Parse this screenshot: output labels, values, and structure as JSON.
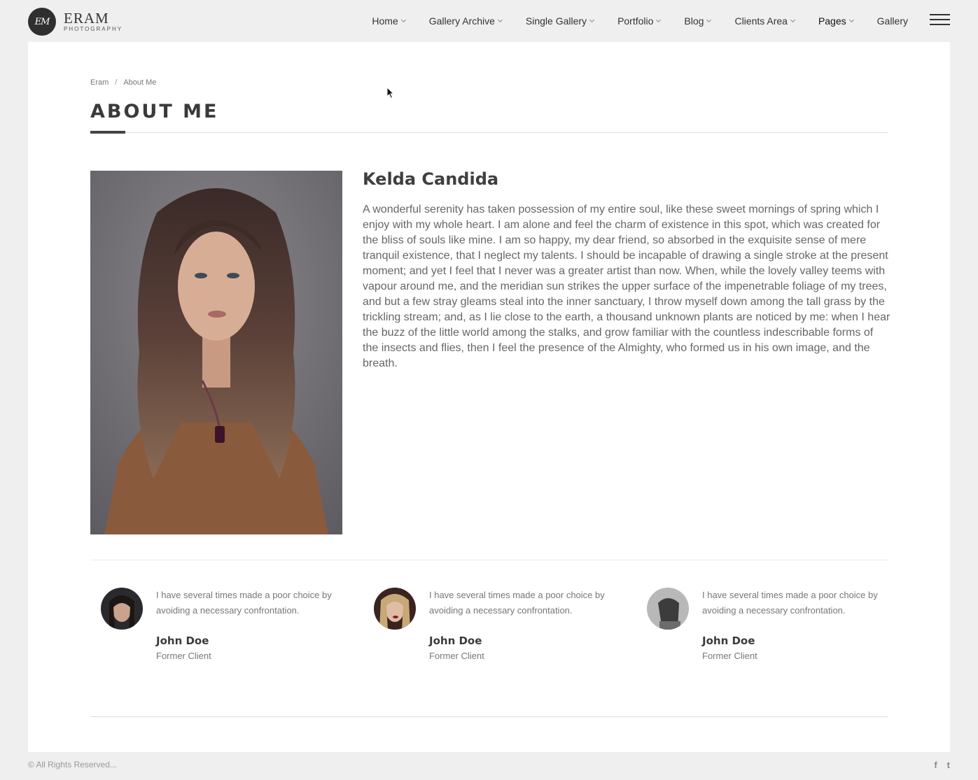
{
  "brand": {
    "monogram": "EM",
    "name": "ERAM",
    "sub": "PHOTOGRAPHY"
  },
  "nav": {
    "items": [
      {
        "label": "Home",
        "dropdown": true
      },
      {
        "label": "Gallery Archive",
        "dropdown": true
      },
      {
        "label": "Single Gallery",
        "dropdown": true
      },
      {
        "label": "Portfolio",
        "dropdown": true
      },
      {
        "label": "Blog",
        "dropdown": true
      },
      {
        "label": "Clients Area",
        "dropdown": true
      },
      {
        "label": "Pages",
        "dropdown": true,
        "active": true
      },
      {
        "label": "Gallery",
        "dropdown": false
      }
    ],
    "menu_icon": "hamburger-icon"
  },
  "breadcrumb": {
    "home": "Eram",
    "separator": "/",
    "current": "About Me"
  },
  "page": {
    "title": "ABOUT ME"
  },
  "profile": {
    "name": "Kelda Candida",
    "bio": "A wonderful serenity has taken possession of my entire soul, like these sweet mornings of spring which I enjoy with my whole heart. I am alone and feel the charm of existence in this spot, which was created for the bliss of souls like mine. I am so happy, my dear friend, so absorbed in the exquisite sense of mere tranquil existence, that I neglect my talents. I should be incapable of drawing a single stroke at the present moment; and yet I feel that I never was a greater artist than now. When, while the lovely valley teems with vapour around me, and the meridian sun strikes the upper surface of the impenetrable foliage of my trees, and but a few stray gleams steal into the inner sanctuary, I throw myself down among the tall grass by the trickling stream; and, as I lie close to the earth, a thousand unknown plants are noticed by me: when I hear the buzz of the little world among the stalks, and grow familiar with the countless indescribable forms of the insects and flies, then I feel the presence of the Almighty, who formed us in his own image, and the breath."
  },
  "testimonials": [
    {
      "quote": "I have several times made a poor choice by avoiding a necessary confrontation.",
      "name": "John Doe",
      "role": "Former Client"
    },
    {
      "quote": "I have several times made a poor choice by avoiding a necessary confrontation.",
      "name": "John Doe",
      "role": "Former Client"
    },
    {
      "quote": "I have several times made a poor choice by avoiding a necessary confrontation.",
      "name": "John Doe",
      "role": "Former Client"
    }
  ],
  "footer": {
    "copyright": "© All Rights Reserved...",
    "social": [
      {
        "icon": "facebook-icon",
        "glyph": "f"
      },
      {
        "icon": "twitter-icon",
        "glyph": "t"
      }
    ]
  },
  "colors": {
    "background": "#efefef",
    "panel": "#ffffff",
    "text_dark": "#3a3a3a",
    "text_muted": "#777777"
  }
}
